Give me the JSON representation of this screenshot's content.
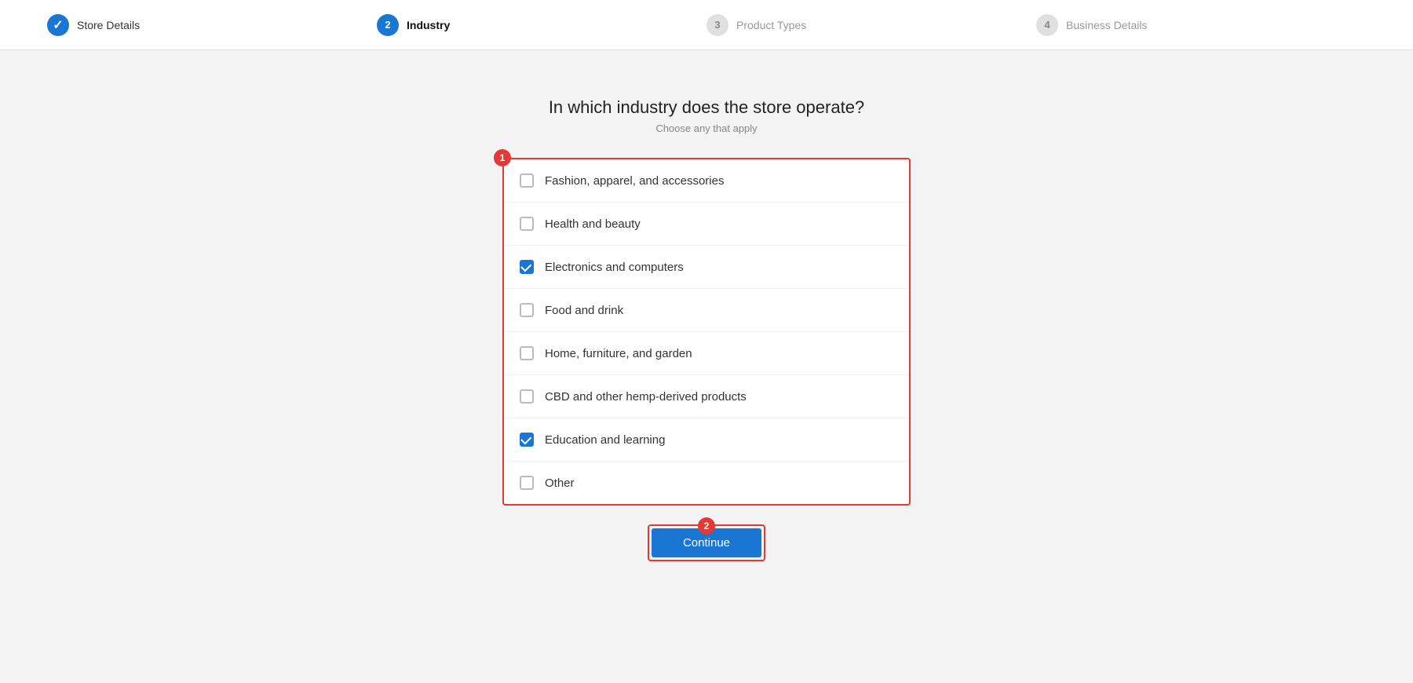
{
  "stepper": {
    "steps": [
      {
        "number": "✓",
        "label": "Store Details",
        "state": "done"
      },
      {
        "number": "2",
        "label": "Industry",
        "state": "active"
      },
      {
        "number": "3",
        "label": "Product Types",
        "state": "inactive"
      },
      {
        "number": "4",
        "label": "Business Details",
        "state": "inactive"
      }
    ]
  },
  "page": {
    "title": "In which industry does the store operate?",
    "subtitle": "Choose any that apply"
  },
  "checklist": {
    "items": [
      {
        "label": "Fashion, apparel, and accessories",
        "checked": false
      },
      {
        "label": "Health and beauty",
        "checked": false
      },
      {
        "label": "Electronics and computers",
        "checked": true
      },
      {
        "label": "Food and drink",
        "checked": false
      },
      {
        "label": "Home, furniture, and garden",
        "checked": false
      },
      {
        "label": "CBD and other hemp-derived products",
        "checked": false
      },
      {
        "label": "Education and learning",
        "checked": true
      },
      {
        "label": "Other",
        "checked": false
      }
    ]
  },
  "buttons": {
    "continue": "Continue"
  },
  "annotations": {
    "badge1": "1",
    "badge2": "2"
  }
}
